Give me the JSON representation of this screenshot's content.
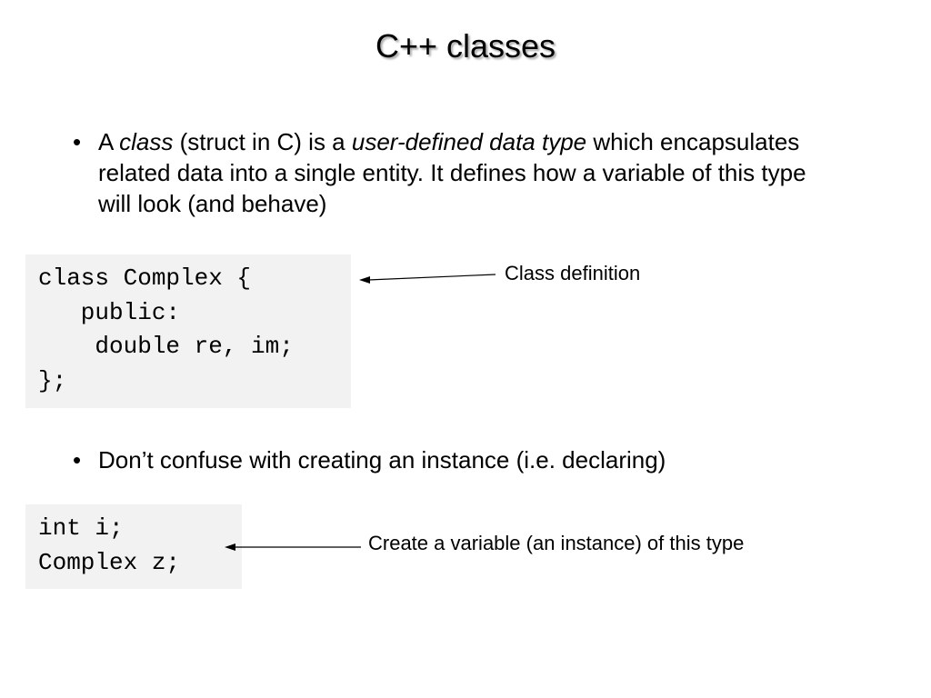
{
  "title": "C++ classes",
  "bullets": {
    "b1": {
      "pre": "A ",
      "it1": "class",
      "mid1": " (struct in C) is a ",
      "it2": "user-defined data type",
      "post": " which encapsulates related data into a single entity.  It defines how a variable of this type will look (and behave)"
    },
    "b2": "Don’t confuse with creating an instance (i.e. declaring)"
  },
  "code": {
    "block1": "class Complex {\n   public:\n    double re, im;\n};",
    "block2": "int i;\nComplex z;"
  },
  "annotations": {
    "a1": "Class definition",
    "a2": "Create a variable (an instance) of this type"
  }
}
